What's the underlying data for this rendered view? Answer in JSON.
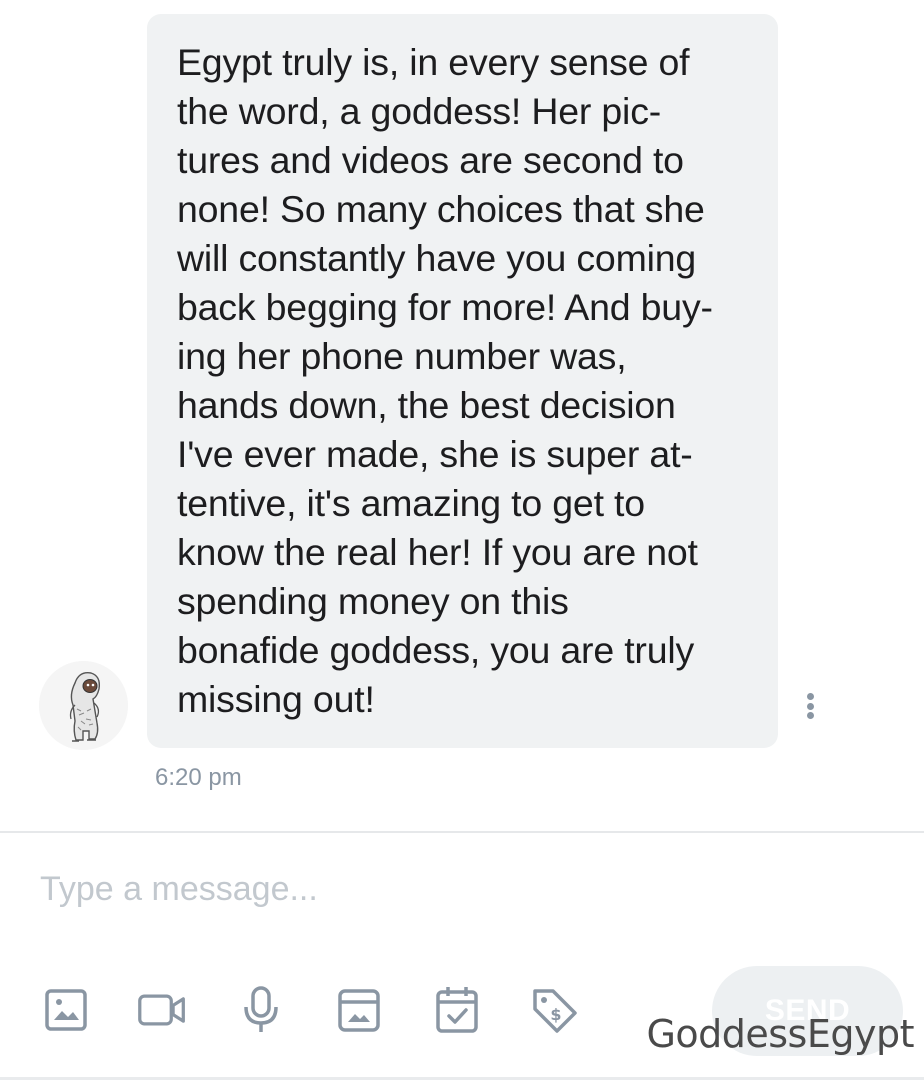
{
  "message": {
    "lines": [
      "Egypt truly is, in every sense of",
      "the word, a goddess! Her pic-",
      "tures and videos are second to",
      "none! So many choices that she",
      "will constantly have you coming",
      "back begging for more! And buy-",
      "ing her phone number was,",
      "hands down, the best decision",
      "I've ever made, she is super at-",
      "tentive, it's amazing to get to",
      "know the real her! If you are not",
      "spending money on this",
      "bonafide goddess, you are truly",
      "missing out!"
    ],
    "time": "6:20 pm"
  },
  "composer": {
    "placeholder": "Type a message...",
    "send_label": "SEND",
    "icons": [
      "image-icon",
      "video-icon",
      "microphone-icon",
      "media-vault-icon",
      "schedule-icon",
      "price-tag-icon"
    ]
  },
  "watermark": "GoddessEgypt",
  "colors": {
    "bubble": "#f0f2f3",
    "text": "#1d1d1f",
    "muted": "#8a96a3",
    "placeholder": "#c2c8ce",
    "send_bg": "#edf0f2"
  }
}
